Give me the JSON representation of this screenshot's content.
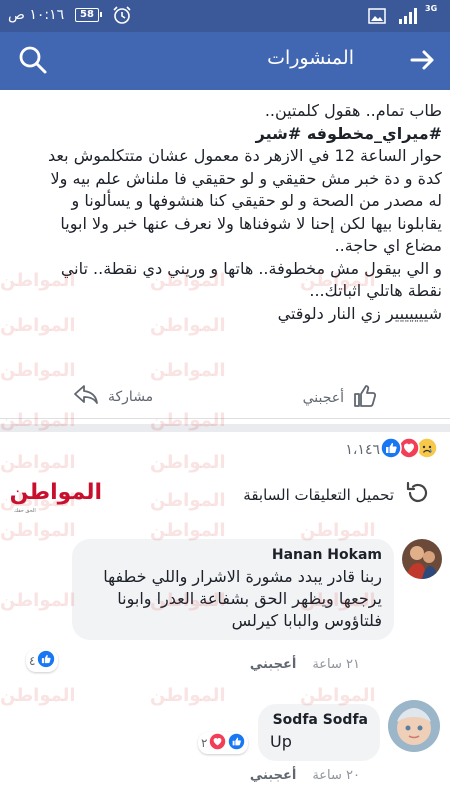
{
  "status_bar": {
    "time": "١٠:١٦ ص",
    "battery": "58",
    "network": "3G"
  },
  "app_bar": {
    "title": "المنشورات",
    "back_icon": "arrow-right-icon",
    "search_icon": "search-icon"
  },
  "post": {
    "lines": [
      "طاب تمام.. هقول كلمتين..",
      "#ميراي_مخطوفه #شير",
      "حوار الساعة 12 في الازهر دة معمول عشان متتكلموش بعد",
      "كدة و دة خبر مش حقيقي و لو حقيقي فا ملناش علم بيه ولا",
      "له مصدر من الصحة و لو حقيقي كنا هنشوفها و يسألونا و",
      "يقابلونا بيها لكن إحنا لا شوفناها ولا نعرف عنها خبر ولا ابويا",
      "مضاع اي حاجة..",
      "و الي بيقول مش مخطوفة.. هاتها و وريني دي نقطة.. تاني",
      "نقطة هاتلي اثباتك...",
      "شييييييير زي النار دلوقتي"
    ],
    "like_label": "أعجبني",
    "share_label": "مشاركة"
  },
  "reactions": {
    "count": "١،١٤٦",
    "types": [
      "like",
      "love",
      "sad"
    ]
  },
  "load_previous": {
    "label": "تحميل التعليقات السابقة"
  },
  "brand": {
    "name": "المواطن",
    "tagline": "الحق حقك"
  },
  "comments": [
    {
      "author": "Hanan Hokam",
      "text": "ربنا قادر يبدد مشورة الاشرار واللي خطفها يرجعها ويظهر الحق بشفاعة العدرا وابونا فلتاؤوس والبابا كيرلس",
      "time": "٢١ ساعة",
      "like_label": "أعجبني",
      "reaction_count": "٤"
    },
    {
      "author": "Sodfa Sodfa",
      "text": "Up",
      "time": "٢٠ ساعة",
      "like_label": "أعجبني",
      "reaction_count": "٢"
    }
  ],
  "watermark": "المواطن",
  "colors": {
    "status_bar": "#3b5998",
    "app_bar": "#4267b2",
    "like_blue": "#1877f2",
    "love_red": "#f33e58",
    "brand_red": "#c8102e"
  }
}
